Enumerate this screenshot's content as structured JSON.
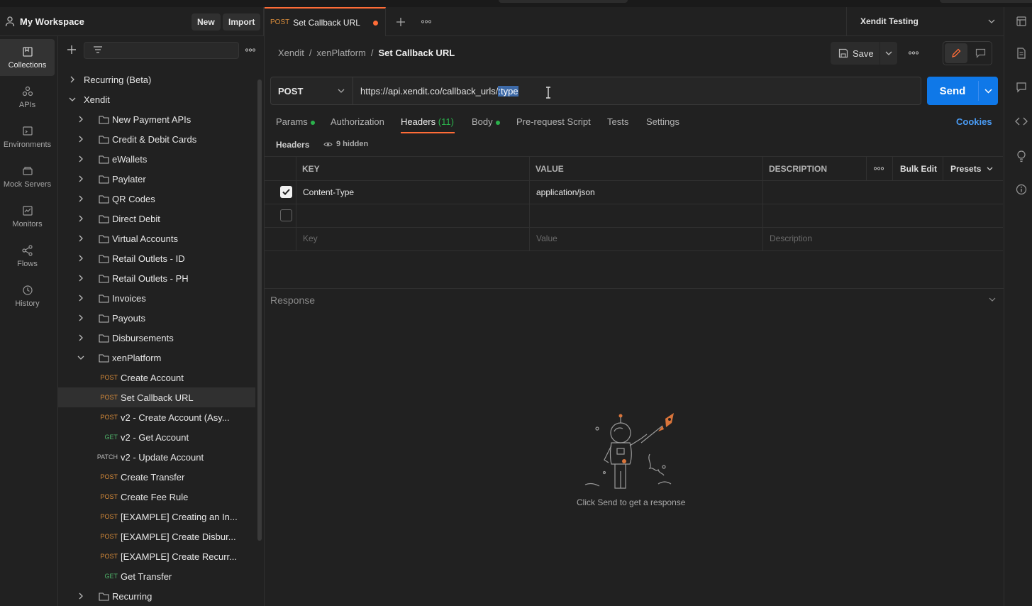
{
  "workspace": {
    "title": "My Workspace",
    "new_label": "New",
    "import_label": "Import"
  },
  "rail": [
    {
      "label": "Collections",
      "icon": "collections-icon"
    },
    {
      "label": "APIs",
      "icon": "apis-icon"
    },
    {
      "label": "Environments",
      "icon": "environments-icon"
    },
    {
      "label": "Mock Servers",
      "icon": "mock-servers-icon"
    },
    {
      "label": "Monitors",
      "icon": "monitors-icon"
    },
    {
      "label": "Flows",
      "icon": "flows-icon"
    },
    {
      "label": "History",
      "icon": "history-icon"
    }
  ],
  "tree": [
    {
      "label": "Recurring (Beta)",
      "kind": "collection"
    },
    {
      "label": "Xendit",
      "kind": "collection-open"
    },
    {
      "label": "New Payment APIs",
      "kind": "folder"
    },
    {
      "label": "Credit & Debit Cards",
      "kind": "folder"
    },
    {
      "label": "eWallets",
      "kind": "folder"
    },
    {
      "label": "Paylater",
      "kind": "folder"
    },
    {
      "label": "QR Codes",
      "kind": "folder"
    },
    {
      "label": "Direct Debit",
      "kind": "folder"
    },
    {
      "label": "Virtual Accounts",
      "kind": "folder"
    },
    {
      "label": "Retail Outlets - ID",
      "kind": "folder"
    },
    {
      "label": "Retail Outlets - PH",
      "kind": "folder"
    },
    {
      "label": "Invoices",
      "kind": "folder"
    },
    {
      "label": "Payouts",
      "kind": "folder"
    },
    {
      "label": "Disbursements",
      "kind": "folder"
    },
    {
      "label": "xenPlatform",
      "kind": "folder-open"
    },
    {
      "label": "Create Account",
      "kind": "request",
      "method": "POST"
    },
    {
      "label": "Set Callback URL",
      "kind": "request",
      "method": "POST",
      "selected": true
    },
    {
      "label": "v2 - Create Account (Asy...",
      "kind": "request",
      "method": "POST"
    },
    {
      "label": "v2 - Get Account",
      "kind": "request",
      "method": "GET"
    },
    {
      "label": "v2 - Update Account",
      "kind": "request",
      "method": "PATCH"
    },
    {
      "label": "Create Transfer",
      "kind": "request",
      "method": "POST"
    },
    {
      "label": "Create Fee Rule",
      "kind": "request",
      "method": "POST"
    },
    {
      "label": "[EXAMPLE] Creating an In...",
      "kind": "request",
      "method": "POST"
    },
    {
      "label": "[EXAMPLE] Create Disbur...",
      "kind": "request",
      "method": "POST"
    },
    {
      "label": "[EXAMPLE] Create Recurr...",
      "kind": "request",
      "method": "POST"
    },
    {
      "label": "Get Transfer",
      "kind": "request",
      "method": "GET"
    },
    {
      "label": "Recurring",
      "kind": "folder"
    }
  ],
  "tab": {
    "method": "POST",
    "title": "Set Callback URL"
  },
  "environment": "Xendit Testing",
  "breadcrumb": {
    "part1": "Xendit",
    "part2": "xenPlatform",
    "current": "Set Callback URL"
  },
  "save_label": "Save",
  "request": {
    "method": "POST",
    "url_prefix": "https://api.xendit.co/callback_urls/",
    "url_selected": ":type",
    "send_label": "Send"
  },
  "req_tabs": {
    "params": "Params",
    "authorization": "Authorization",
    "headers": "Headers",
    "headers_count": "(11)",
    "body": "Body",
    "prerequest": "Pre-request Script",
    "tests": "Tests",
    "settings": "Settings",
    "cookies": "Cookies"
  },
  "headers_section": {
    "label": "Headers",
    "hidden": "9 hidden"
  },
  "table": {
    "col_key": "KEY",
    "col_value": "VALUE",
    "col_desc": "DESCRIPTION",
    "bulk_edit": "Bulk Edit",
    "presets": "Presets",
    "rows": [
      {
        "checked": true,
        "key": "Content-Type",
        "value": "application/json",
        "description": ""
      },
      {
        "checked": false,
        "key": "",
        "value": "",
        "description": ""
      }
    ],
    "placeholder_key": "Key",
    "placeholder_value": "Value",
    "placeholder_desc": "Description"
  },
  "response": {
    "label": "Response",
    "empty_text": "Click Send to get a response"
  },
  "colors": {
    "accent": "#ff6c37",
    "send": "#0f78e8",
    "link": "#4a9cf5"
  }
}
